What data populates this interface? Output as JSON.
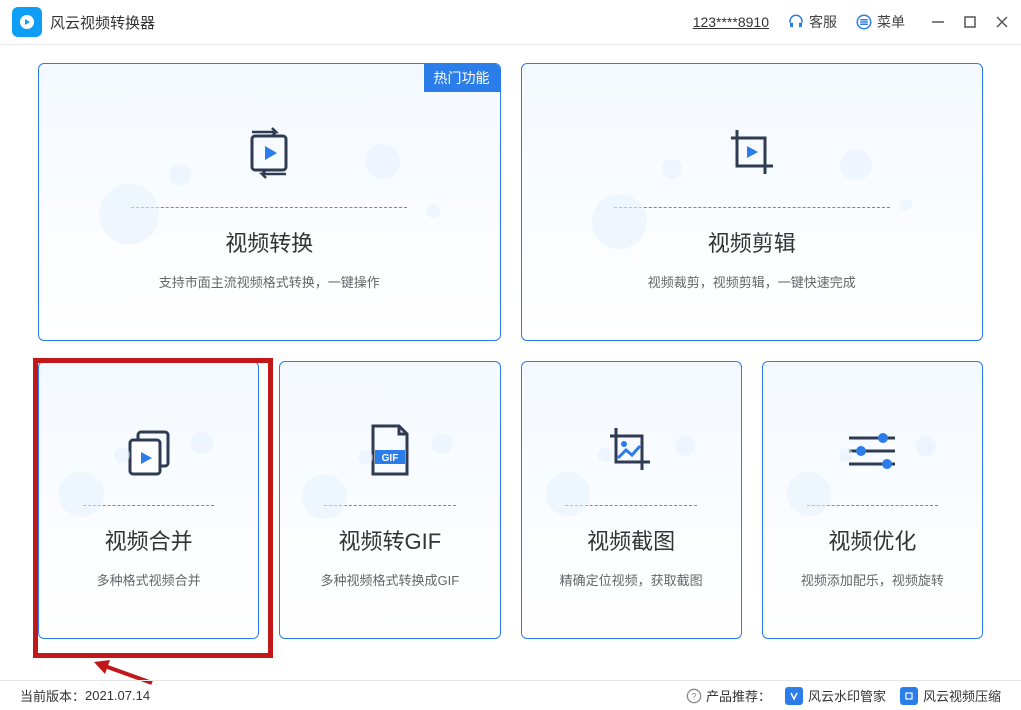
{
  "app": {
    "title": "风云视频转换器"
  },
  "header": {
    "user_id": "123****8910",
    "support": "客服",
    "menu": "菜单"
  },
  "badge_hot": "热门功能",
  "cards": {
    "big": [
      {
        "title": "视频转换",
        "desc": "支持市面主流视频格式转换，一键操作"
      },
      {
        "title": "视频剪辑",
        "desc": "视频裁剪，视频剪辑，一键快速完成"
      }
    ],
    "small": [
      {
        "title": "视频合并",
        "desc": "多种格式视频合并"
      },
      {
        "title": "视频转GIF",
        "desc": "多种视频格式转换成GIF"
      },
      {
        "title": "视频截图",
        "desc": "精确定位视频，获取截图"
      },
      {
        "title": "视频优化",
        "desc": "视频添加配乐，视频旋转"
      }
    ]
  },
  "gif_label": "GIF",
  "footer": {
    "version_label": "当前版本：",
    "version": "2021.07.14",
    "recommend_label": "产品推荐：",
    "rec1": "风云水印管家",
    "rec2": "风云视频压缩"
  }
}
